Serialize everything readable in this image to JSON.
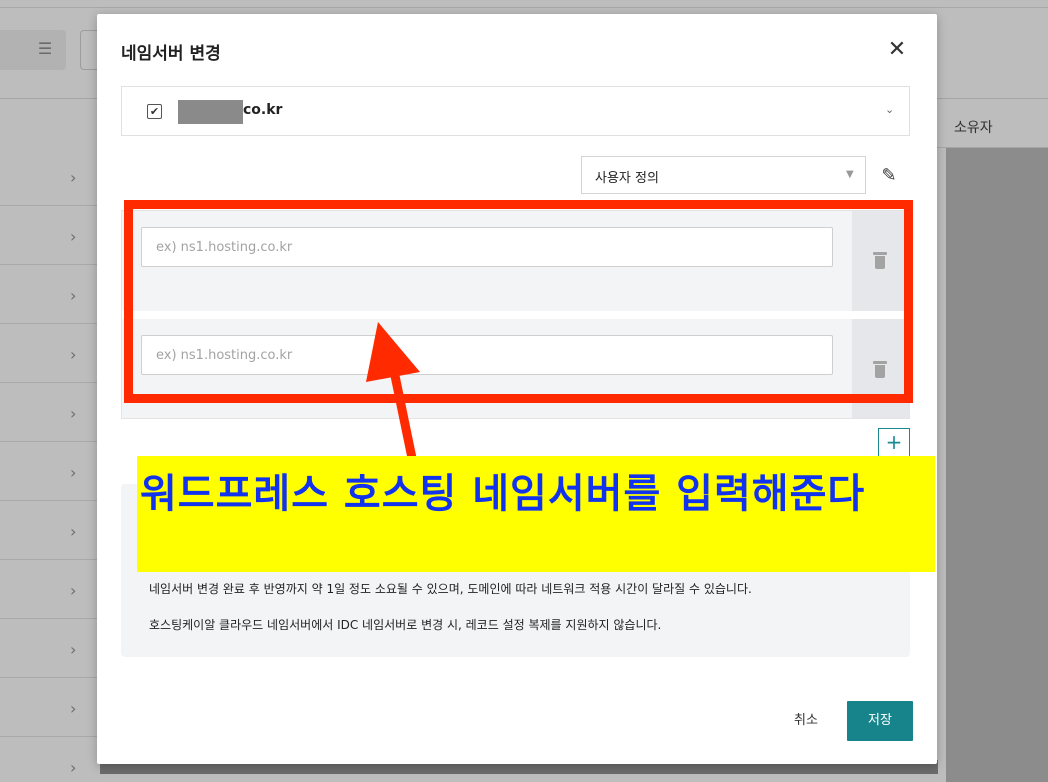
{
  "background": {
    "owner_column_label": "소유자",
    "filter_icon": "sliders-icon",
    "row_chevron_icon": "chevron-right-icon",
    "row_count": 11
  },
  "modal": {
    "title": "네임서버 변경",
    "close_icon": "close-icon",
    "domain_select": {
      "checked": true,
      "domain_suffix": "co.kr",
      "chevron_icon": "chevron-down-icon"
    },
    "preset_select": {
      "value": "사용자 정의",
      "edit_icon": "edit-note-icon"
    },
    "nameservers": [
      {
        "value": "",
        "placeholder": "ex) ns1.hosting.co.kr",
        "delete_icon": "trash-icon"
      },
      {
        "value": "",
        "placeholder": "ex) ns1.hosting.co.kr",
        "delete_icon": "trash-icon"
      }
    ],
    "add_label": "+",
    "notice": [
      "네임서버 변경 완료 후 반영까지 약 1일 정도 소요될 수 있으며, 도메인에 따라 네트워크 적용 시간이 달라질 수 있습니다.",
      "호스팅케이알 클라우드 네임서버에서 IDC 네임서버로 변경 시, 레코드 설정 복제를 지원하지 않습니다."
    ],
    "cancel_label": "취소",
    "save_label": "저장"
  },
  "annotation": {
    "banner_text": "워드프레스 호스팅 네임서버를 입력해준다",
    "highlight_color": "#ff2a00",
    "banner_color": "#ffff00",
    "banner_text_color": "#1133ee"
  },
  "colors": {
    "accent": "#17848b",
    "overlay": "#bdbdbd"
  }
}
